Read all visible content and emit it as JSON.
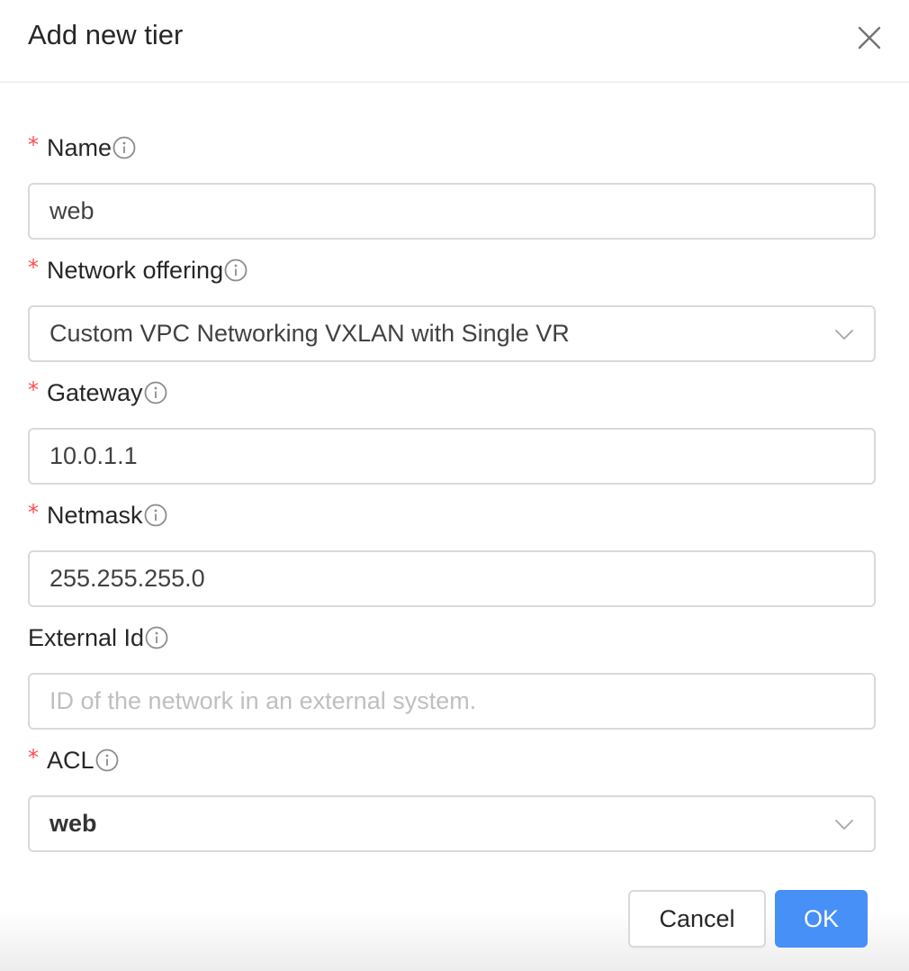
{
  "dialog": {
    "title": "Add new tier"
  },
  "form": {
    "name": {
      "label": "Name",
      "required": true,
      "value": "web"
    },
    "network_offering": {
      "label": "Network offering",
      "required": true,
      "selected": "Custom VPC Networking VXLAN with Single VR"
    },
    "gateway": {
      "label": "Gateway",
      "required": true,
      "value": "10.0.1.1"
    },
    "netmask": {
      "label": "Netmask",
      "required": true,
      "value": "255.255.255.0"
    },
    "external_id": {
      "label": "External Id",
      "required": false,
      "value": "",
      "placeholder": "ID of the network in an external system."
    },
    "acl": {
      "label": "ACL",
      "required": true,
      "selected": "web"
    }
  },
  "required_marker": "*",
  "footer": {
    "cancel_label": "Cancel",
    "ok_label": "OK"
  },
  "colors": {
    "primary": "#4690f7",
    "required": "#ff4d4f",
    "border": "#d9d9d9",
    "placeholder": "#bfbfbf"
  }
}
